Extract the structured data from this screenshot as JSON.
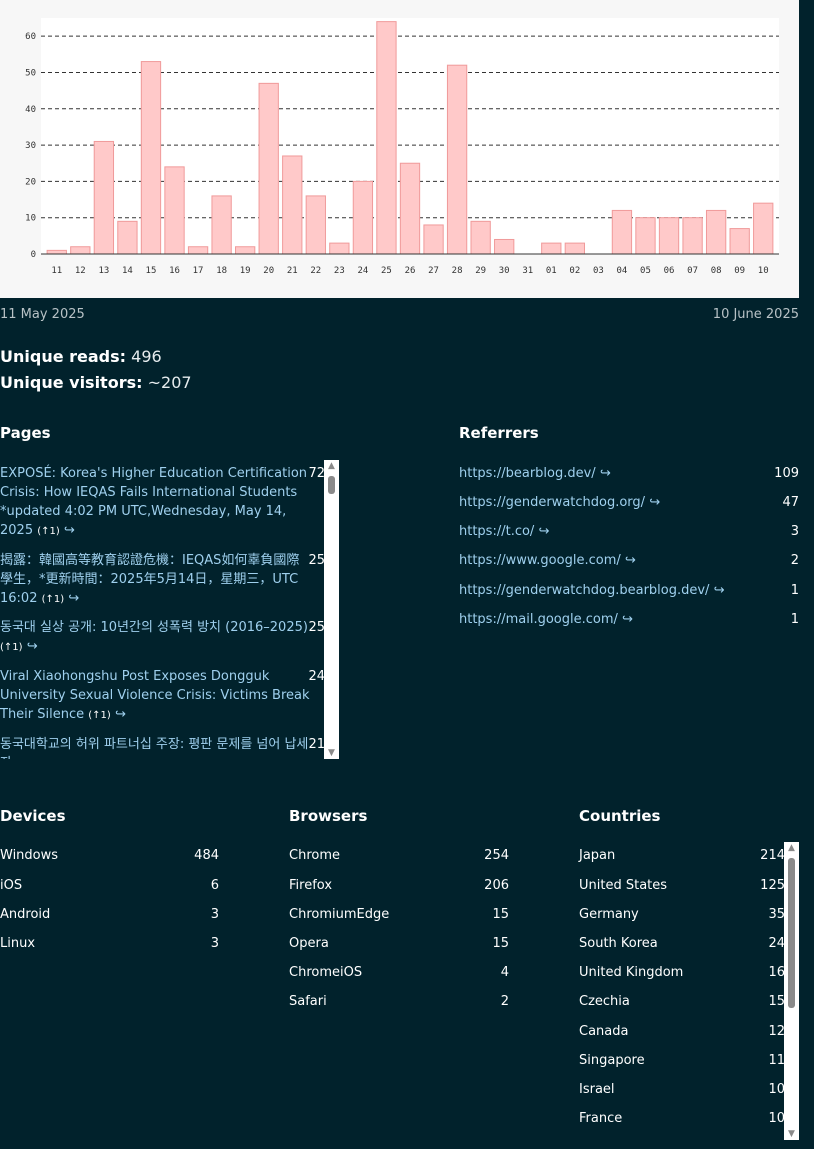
{
  "chart_data": {
    "type": "bar",
    "categories": [
      "11",
      "12",
      "13",
      "14",
      "15",
      "16",
      "17",
      "18",
      "19",
      "20",
      "21",
      "22",
      "23",
      "24",
      "25",
      "26",
      "27",
      "28",
      "29",
      "30",
      "31",
      "01",
      "02",
      "03",
      "04",
      "05",
      "06",
      "07",
      "08",
      "09",
      "10"
    ],
    "values": [
      1,
      2,
      31,
      9,
      53,
      24,
      2,
      16,
      2,
      47,
      27,
      16,
      3,
      20,
      64,
      25,
      8,
      52,
      9,
      4,
      0,
      3,
      3,
      0,
      12,
      10,
      10,
      10,
      12,
      7,
      14
    ],
    "ylim": [
      0,
      65
    ],
    "yticks": [
      0,
      10,
      20,
      30,
      40,
      50,
      60
    ],
    "grid": true,
    "bar_color": "#ffc9c9",
    "bar_stroke": "#f09a9a"
  },
  "dates": {
    "start": "11 May 2025",
    "end": "10 June 2025"
  },
  "summary": {
    "reads_label": "Unique reads:",
    "reads_value": "496",
    "visitors_label": "Unique visitors:",
    "visitors_value": "~207"
  },
  "pages": {
    "heading": "Pages",
    "items": [
      {
        "title": "EXPOSÉ: Korea's Higher Education Certification Crisis: How IEQAS Fails International Students *updated 4:02 PM UTC,Wednesday, May 14, 2025",
        "count": "72",
        "note": "(↑1)"
      },
      {
        "title": "揭露：韓國高等教育認證危機：IEQAS如何辜負國際學生，*更新時間：2025年5月14日，星期三，UTC 16:02",
        "count": "25",
        "note": "(↑1)"
      },
      {
        "title": "동국대 실상 공개: 10년간의 성폭력 방치 (2016–2025)",
        "count": "25",
        "note": "(↑1)"
      },
      {
        "title": "Viral Xiaohongshu Post Exposes Dongguk University Sexual Violence Crisis: Victims Break Their Silence",
        "count": "24",
        "note": "(↑1)"
      },
      {
        "title": "동국대학교의 허위 파트너십 주장: 평판 문제를 넘어 납세자",
        "count": "21",
        "note": ""
      }
    ]
  },
  "referrers": {
    "heading": "Referrers",
    "items": [
      {
        "url": "https://bearblog.dev/",
        "count": "109"
      },
      {
        "url": "https://genderwatchdog.org/",
        "count": "47"
      },
      {
        "url": "https://t.co/",
        "count": "3"
      },
      {
        "url": "https://www.google.com/",
        "count": "2"
      },
      {
        "url": "https://genderwatchdog.bearblog.dev/",
        "count": "1"
      },
      {
        "url": "https://mail.google.com/",
        "count": "1"
      }
    ]
  },
  "devices": {
    "heading": "Devices",
    "items": [
      {
        "name": "Windows",
        "count": "484"
      },
      {
        "name": "iOS",
        "count": "6"
      },
      {
        "name": "Android",
        "count": "3"
      },
      {
        "name": "Linux",
        "count": "3"
      }
    ]
  },
  "browsers": {
    "heading": "Browsers",
    "items": [
      {
        "name": "Chrome",
        "count": "254"
      },
      {
        "name": "Firefox",
        "count": "206"
      },
      {
        "name": "ChromiumEdge",
        "count": "15"
      },
      {
        "name": "Opera",
        "count": "15"
      },
      {
        "name": "ChromeiOS",
        "count": "4"
      },
      {
        "name": "Safari",
        "count": "2"
      }
    ]
  },
  "countries": {
    "heading": "Countries",
    "items": [
      {
        "name": "Japan",
        "count": "214"
      },
      {
        "name": "United States",
        "count": "125"
      },
      {
        "name": "Germany",
        "count": "35"
      },
      {
        "name": "South Korea",
        "count": "24"
      },
      {
        "name": "United Kingdom",
        "count": "16"
      },
      {
        "name": "Czechia",
        "count": "15"
      },
      {
        "name": "Canada",
        "count": "12"
      },
      {
        "name": "Singapore",
        "count": "11"
      },
      {
        "name": "Israel",
        "count": "10"
      },
      {
        "name": "France",
        "count": "10"
      }
    ]
  },
  "icons": {
    "link_arrow": "↪",
    "arrow_up": "▲",
    "arrow_down": "▼"
  }
}
